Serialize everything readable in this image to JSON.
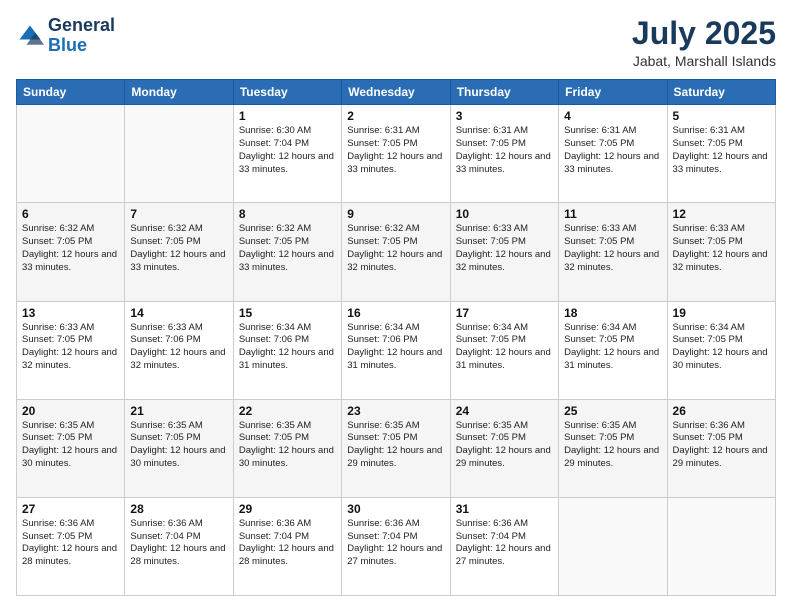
{
  "logo": {
    "line1": "General",
    "line2": "Blue"
  },
  "header": {
    "month_year": "July 2025",
    "location": "Jabat, Marshall Islands"
  },
  "days_of_week": [
    "Sunday",
    "Monday",
    "Tuesday",
    "Wednesday",
    "Thursday",
    "Friday",
    "Saturday"
  ],
  "weeks": [
    [
      {
        "day": "",
        "text": ""
      },
      {
        "day": "",
        "text": ""
      },
      {
        "day": "1",
        "text": "Sunrise: 6:30 AM\nSunset: 7:04 PM\nDaylight: 12 hours\nand 33 minutes."
      },
      {
        "day": "2",
        "text": "Sunrise: 6:31 AM\nSunset: 7:05 PM\nDaylight: 12 hours\nand 33 minutes."
      },
      {
        "day": "3",
        "text": "Sunrise: 6:31 AM\nSunset: 7:05 PM\nDaylight: 12 hours\nand 33 minutes."
      },
      {
        "day": "4",
        "text": "Sunrise: 6:31 AM\nSunset: 7:05 PM\nDaylight: 12 hours\nand 33 minutes."
      },
      {
        "day": "5",
        "text": "Sunrise: 6:31 AM\nSunset: 7:05 PM\nDaylight: 12 hours\nand 33 minutes."
      }
    ],
    [
      {
        "day": "6",
        "text": "Sunrise: 6:32 AM\nSunset: 7:05 PM\nDaylight: 12 hours\nand 33 minutes."
      },
      {
        "day": "7",
        "text": "Sunrise: 6:32 AM\nSunset: 7:05 PM\nDaylight: 12 hours\nand 33 minutes."
      },
      {
        "day": "8",
        "text": "Sunrise: 6:32 AM\nSunset: 7:05 PM\nDaylight: 12 hours\nand 33 minutes."
      },
      {
        "day": "9",
        "text": "Sunrise: 6:32 AM\nSunset: 7:05 PM\nDaylight: 12 hours\nand 32 minutes."
      },
      {
        "day": "10",
        "text": "Sunrise: 6:33 AM\nSunset: 7:05 PM\nDaylight: 12 hours\nand 32 minutes."
      },
      {
        "day": "11",
        "text": "Sunrise: 6:33 AM\nSunset: 7:05 PM\nDaylight: 12 hours\nand 32 minutes."
      },
      {
        "day": "12",
        "text": "Sunrise: 6:33 AM\nSunset: 7:05 PM\nDaylight: 12 hours\nand 32 minutes."
      }
    ],
    [
      {
        "day": "13",
        "text": "Sunrise: 6:33 AM\nSunset: 7:05 PM\nDaylight: 12 hours\nand 32 minutes."
      },
      {
        "day": "14",
        "text": "Sunrise: 6:33 AM\nSunset: 7:06 PM\nDaylight: 12 hours\nand 32 minutes."
      },
      {
        "day": "15",
        "text": "Sunrise: 6:34 AM\nSunset: 7:06 PM\nDaylight: 12 hours\nand 31 minutes."
      },
      {
        "day": "16",
        "text": "Sunrise: 6:34 AM\nSunset: 7:06 PM\nDaylight: 12 hours\nand 31 minutes."
      },
      {
        "day": "17",
        "text": "Sunrise: 6:34 AM\nSunset: 7:05 PM\nDaylight: 12 hours\nand 31 minutes."
      },
      {
        "day": "18",
        "text": "Sunrise: 6:34 AM\nSunset: 7:05 PM\nDaylight: 12 hours\nand 31 minutes."
      },
      {
        "day": "19",
        "text": "Sunrise: 6:34 AM\nSunset: 7:05 PM\nDaylight: 12 hours\nand 30 minutes."
      }
    ],
    [
      {
        "day": "20",
        "text": "Sunrise: 6:35 AM\nSunset: 7:05 PM\nDaylight: 12 hours\nand 30 minutes."
      },
      {
        "day": "21",
        "text": "Sunrise: 6:35 AM\nSunset: 7:05 PM\nDaylight: 12 hours\nand 30 minutes."
      },
      {
        "day": "22",
        "text": "Sunrise: 6:35 AM\nSunset: 7:05 PM\nDaylight: 12 hours\nand 30 minutes."
      },
      {
        "day": "23",
        "text": "Sunrise: 6:35 AM\nSunset: 7:05 PM\nDaylight: 12 hours\nand 29 minutes."
      },
      {
        "day": "24",
        "text": "Sunrise: 6:35 AM\nSunset: 7:05 PM\nDaylight: 12 hours\nand 29 minutes."
      },
      {
        "day": "25",
        "text": "Sunrise: 6:35 AM\nSunset: 7:05 PM\nDaylight: 12 hours\nand 29 minutes."
      },
      {
        "day": "26",
        "text": "Sunrise: 6:36 AM\nSunset: 7:05 PM\nDaylight: 12 hours\nand 29 minutes."
      }
    ],
    [
      {
        "day": "27",
        "text": "Sunrise: 6:36 AM\nSunset: 7:05 PM\nDaylight: 12 hours\nand 28 minutes."
      },
      {
        "day": "28",
        "text": "Sunrise: 6:36 AM\nSunset: 7:04 PM\nDaylight: 12 hours\nand 28 minutes."
      },
      {
        "day": "29",
        "text": "Sunrise: 6:36 AM\nSunset: 7:04 PM\nDaylight: 12 hours\nand 28 minutes."
      },
      {
        "day": "30",
        "text": "Sunrise: 6:36 AM\nSunset: 7:04 PM\nDaylight: 12 hours\nand 27 minutes."
      },
      {
        "day": "31",
        "text": "Sunrise: 6:36 AM\nSunset: 7:04 PM\nDaylight: 12 hours\nand 27 minutes."
      },
      {
        "day": "",
        "text": ""
      },
      {
        "day": "",
        "text": ""
      }
    ]
  ]
}
